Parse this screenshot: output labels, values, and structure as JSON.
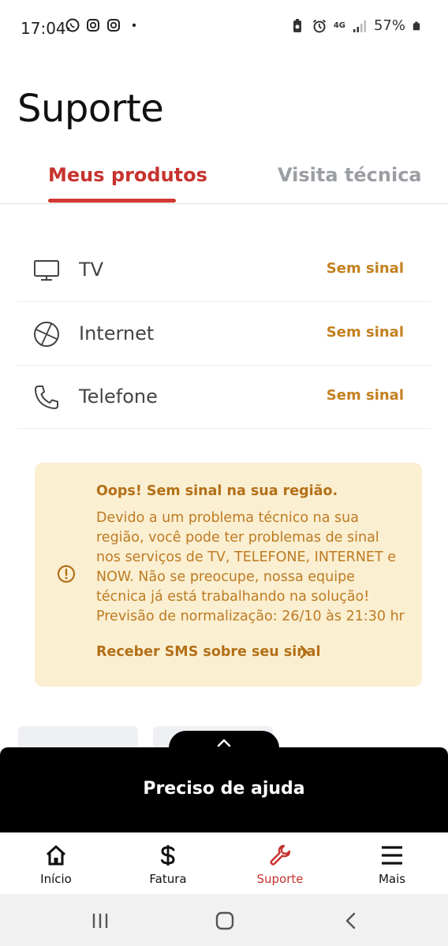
{
  "status_bar": {
    "time": "17:04",
    "battery": "57%",
    "network": "4G",
    "app_icons": [
      "whatsapp-icon",
      "instagram-icon",
      "instagram-icon",
      "dot"
    ]
  },
  "page": {
    "title": "Suporte"
  },
  "tabs": [
    {
      "label": "Meus produtos",
      "active": true
    },
    {
      "label": "Visita técnica",
      "active": false
    }
  ],
  "products": [
    {
      "icon": "tv-icon",
      "label": "TV",
      "status": "Sem sinal"
    },
    {
      "icon": "globe-icon",
      "label": "Internet",
      "status": "Sem sinal"
    },
    {
      "icon": "phone-icon",
      "label": "Telefone",
      "status": "Sem sinal"
    }
  ],
  "alert": {
    "title": "Oops! Sem sinal na sua região.",
    "body": "Devido a um problema técnico na sua região, você pode ter problemas de sinal nos serviços de TV, TELEFONE, INTERNET e NOW. Não se preocupe, nossa equipe técnica já está trabalhando na solução! Previsão de normalização: 26/10 às 21:30 hr",
    "link_label": "Receber SMS sobre seu sinal"
  },
  "help_sheet": {
    "label": "Preciso de ajuda"
  },
  "bottom_nav": [
    {
      "icon": "home-icon",
      "label": "Início",
      "active": false
    },
    {
      "icon": "dollar-icon",
      "label": "Fatura",
      "active": false
    },
    {
      "icon": "wrench-icon",
      "label": "Suporte",
      "active": true
    },
    {
      "icon": "menu-icon",
      "label": "Mais",
      "active": false
    }
  ],
  "colors": {
    "accent_red": "#c7332f",
    "status_orange": "#c4801f",
    "alert_bg": "#fbefd2",
    "sheet_bg": "#000000"
  }
}
